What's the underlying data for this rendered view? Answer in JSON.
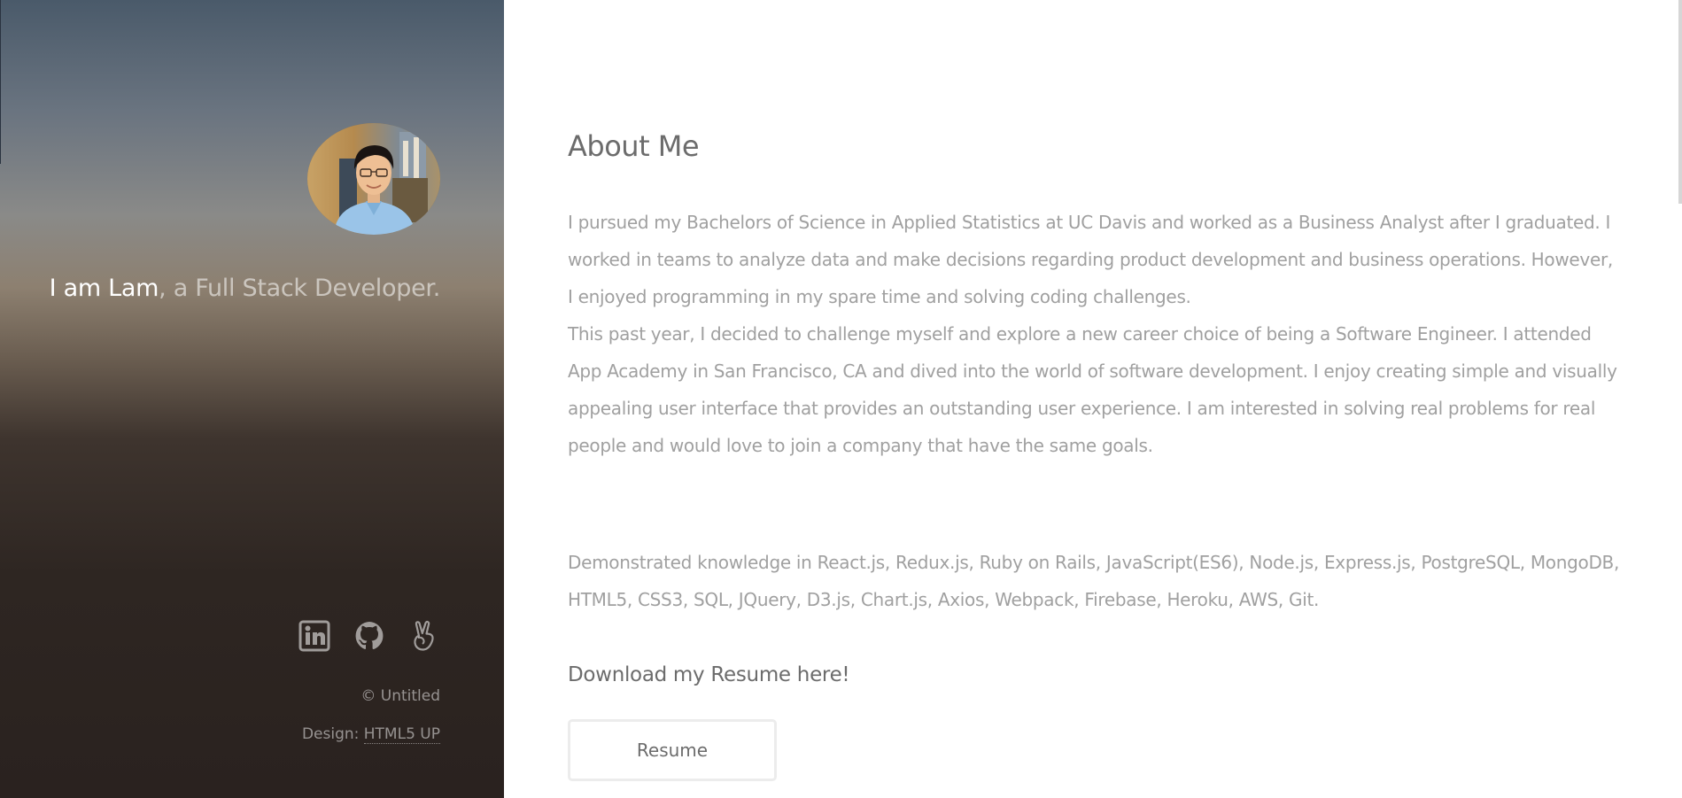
{
  "sidebar": {
    "tagline_name": "I am Lam",
    "tagline_rest": ", a Full Stack Developer.",
    "social_icons": [
      "linkedin-icon",
      "github-icon",
      "angellist-icon"
    ],
    "copyright": "© Untitled",
    "design_prefix": "Design: ",
    "design_link": "HTML5 UP"
  },
  "main": {
    "heading": "About Me",
    "paragraph_1": "I pursued my Bachelors of Science in Applied Statistics at UC Davis and worked as a Business Analyst after I graduated. I worked in teams to analyze data and make decisions regarding product development and business operations. However, I enjoyed programming in my spare time and solving coding challenges.",
    "paragraph_2": "This past year, I decided to challenge myself and explore a new career choice of being a Software Engineer. I attended App Academy in San Francisco, CA and dived into the world of software development. I enjoy creating simple and visually appealing user interface that provides an outstanding user experience. I am interested in solving real problems for real people and would love to join a company that have the same goals.",
    "paragraph_3": "Demonstrated knowledge in React.js, Redux.js, Ruby on Rails, JavaScript(ES6), Node.js, Express.js, PostgreSQL, MongoDB, HTML5, CSS3, SQL, JQuery, D3.js, Chart.js, Axios, Webpack, Firebase, Heroku, AWS, Git.",
    "download_text": "Download my Resume here!",
    "resume_button": "Resume"
  },
  "colors": {
    "heading": "#6c6c6c",
    "body_text": "#a0a0a0",
    "button_border": "#ececec"
  }
}
